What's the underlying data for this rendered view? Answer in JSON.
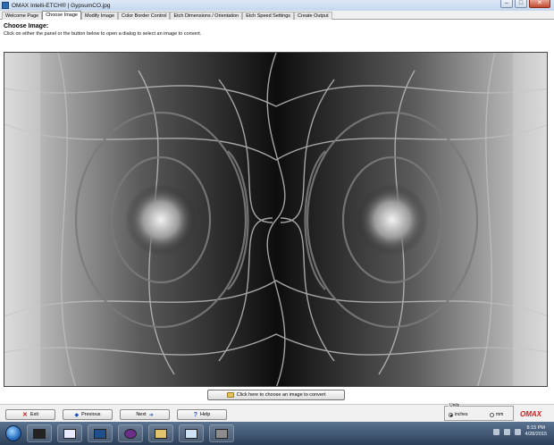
{
  "window": {
    "title": "OMAX Intelli-ETCH® | GypsumCO.jpg"
  },
  "tabs": [
    {
      "label": "Welcome Page",
      "active": false
    },
    {
      "label": "Choose Image",
      "active": true
    },
    {
      "label": "Modify Image",
      "active": false
    },
    {
      "label": "Color Border Control",
      "active": false
    },
    {
      "label": "Etch Dimensions / Orientation",
      "active": false
    },
    {
      "label": "Etch Speed Settings",
      "active": false
    },
    {
      "label": "Create Output",
      "active": false
    }
  ],
  "main": {
    "heading": "Choose Image:",
    "instructions": "Click on either the panel or the button below to open a dialog to select an image to convert.",
    "choose_button": "Click here to choose an image to convert"
  },
  "bottom": {
    "exit_label": "Exit",
    "previous_label": "Previous",
    "next_label": "Next",
    "help_label": "Help",
    "units_title": "Units",
    "units_inches": "inches",
    "units_mm": "mm",
    "units_selected": "inches",
    "logo_text": "OMAX"
  },
  "taskbar": {
    "time": "8:15 PM",
    "date": "4/28/2015"
  },
  "colors": {
    "accent": "#1a4fc2",
    "logo": "#d11a1a",
    "exit": "#c81e1e"
  }
}
